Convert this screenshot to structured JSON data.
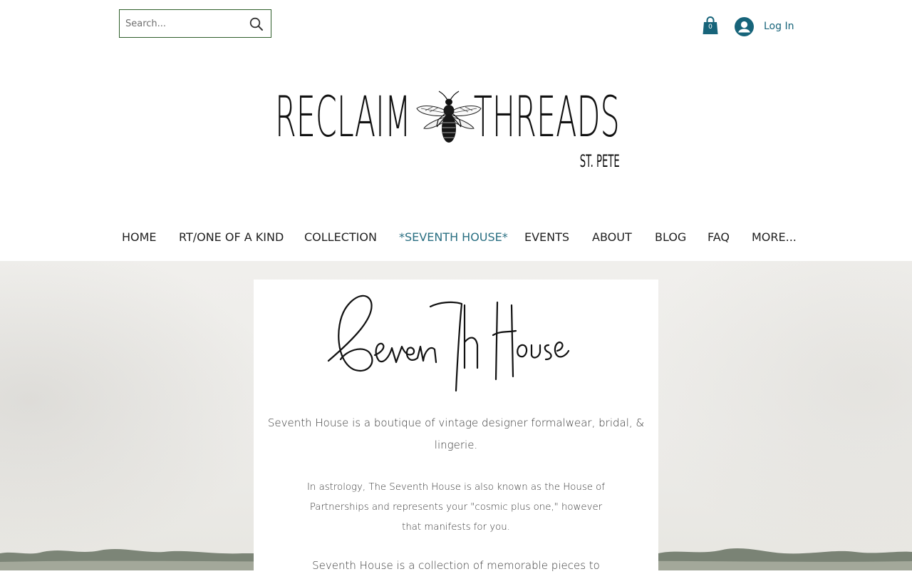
{
  "header": {
    "search": {
      "placeholder": "Search..."
    },
    "cart": {
      "count": "0"
    },
    "login": {
      "label": "Log In"
    }
  },
  "logo": {
    "word_left": "RECLAIM",
    "word_right": "THREADS",
    "subtitle": "ST. PETE"
  },
  "nav": {
    "items": [
      {
        "label": "HOME"
      },
      {
        "label": "RT/ONE OF A KIND"
      },
      {
        "label": "COLLECTION"
      },
      {
        "label": "*SEVENTH HOUSE*"
      },
      {
        "label": "EVENTS"
      },
      {
        "label": "ABOUT"
      },
      {
        "label": "BLOG"
      },
      {
        "label": "FAQ"
      },
      {
        "label": "MORE..."
      }
    ],
    "active_index": 3
  },
  "content": {
    "script_logo_text": "Seventh House",
    "paragraph1": "Seventh House is a boutique of vintage designer formalwear, bridal, & lingerie.",
    "paragraph2": "In astrology, The Seventh House is also known as the House of Partnerships and represents your \"cosmic plus one,\" however that manifests for you.",
    "paragraph3": "Seventh House is a collection of memorable pieces to"
  },
  "colors": {
    "accent": "#17647a",
    "nav_active": "#2a6f82",
    "search_border": "#2f5e2a"
  },
  "icons": [
    "search-icon",
    "cart-icon",
    "user-icon",
    "bee-icon"
  ]
}
